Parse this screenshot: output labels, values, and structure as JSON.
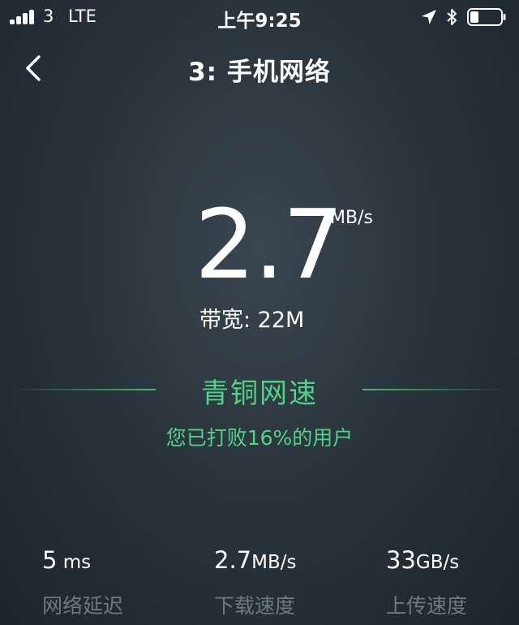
{
  "status_bar": {
    "carrier": "3",
    "network_type": "LTE",
    "time": "上午9:25",
    "signal_bars": 4,
    "icons": [
      "signal-icon",
      "location-icon",
      "bluetooth-icon",
      "battery-icon"
    ]
  },
  "header": {
    "title": "3: 手机网络",
    "back_icon": "chevron-left-icon"
  },
  "speed": {
    "value": "2.7",
    "unit": "MB/s",
    "bandwidth": "带宽: 22M"
  },
  "rank": {
    "title": "青铜网速",
    "description": "您已打败16%的用户",
    "color": "#4fd386"
  },
  "stats": [
    {
      "value": "5",
      "unit": " ms",
      "label": "网络延迟"
    },
    {
      "value": "2.7",
      "unit": "MB/s",
      "label": "下载速度"
    },
    {
      "value": "33",
      "unit": "GB/s",
      "label": "上传速度"
    }
  ],
  "colors": {
    "background": "#2a343c",
    "accent": "#4fd386",
    "muted_label": "#6d7a82"
  }
}
